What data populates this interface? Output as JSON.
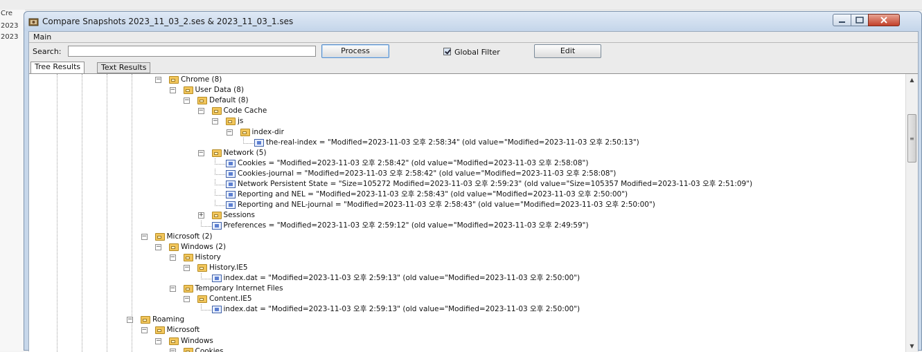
{
  "background": {
    "texts": [
      "Cre",
      "2023",
      "2023"
    ]
  },
  "window": {
    "title": "Compare Snapshots 2023_11_03_2.ses & 2023_11_03_1.ses",
    "buttons": {
      "minimize": "minimize-icon",
      "maximize": "maximize-icon",
      "close": "close-icon"
    }
  },
  "menu": {
    "main_label": "Main"
  },
  "search": {
    "label": "Search:",
    "value": "",
    "placeholder": ""
  },
  "toolbar": {
    "process_label": "Process",
    "global_filter_label": "Global Filter",
    "global_filter_checked": true,
    "edit_label": "Edit"
  },
  "tabs": [
    {
      "label": "Tree Results",
      "active": true
    },
    {
      "label": "Text Results",
      "active": false
    }
  ],
  "tree": {
    "rows": [
      {
        "depth": 0,
        "icon": "folder",
        "label": "Chrome (8)"
      },
      {
        "depth": 1,
        "icon": "folder",
        "label": "User Data (8)"
      },
      {
        "depth": 2,
        "icon": "folder",
        "label": "Default (8)"
      },
      {
        "depth": 3,
        "icon": "folder",
        "label": "Code Cache"
      },
      {
        "depth": 4,
        "icon": "folder",
        "label": "js"
      },
      {
        "depth": 5,
        "icon": "folder",
        "label": "index-dir"
      },
      {
        "depth": 6,
        "icon": "file",
        "label": "the-real-index = \"Modified=2023-11-03 오후 2:58:34\" (old value=\"Modified=2023-11-03 오후 2:50:13\")"
      },
      {
        "depth": 3,
        "icon": "folder",
        "label": "Network (5)"
      },
      {
        "depth": 4,
        "icon": "file",
        "label": "Cookies = \"Modified=2023-11-03 오후 2:58:42\" (old value=\"Modified=2023-11-03 오후 2:58:08\")"
      },
      {
        "depth": 4,
        "icon": "file",
        "label": "Cookies-journal = \"Modified=2023-11-03 오후 2:58:42\" (old value=\"Modified=2023-11-03 오후 2:58:08\")"
      },
      {
        "depth": 4,
        "icon": "file",
        "label": "Network Persistent State = \"Size=105272 Modified=2023-11-03 오후 2:59:23\" (old value=\"Size=105357 Modified=2023-11-03 오후 2:51:09\")"
      },
      {
        "depth": 4,
        "icon": "file",
        "label": "Reporting and NEL = \"Modified=2023-11-03 오후 2:58:43\" (old value=\"Modified=2023-11-03 오후 2:50:00\")"
      },
      {
        "depth": 4,
        "icon": "file",
        "label": "Reporting and NEL-journal = \"Modified=2023-11-03 오후 2:58:43\" (old value=\"Modified=2023-11-03 오후 2:50:00\")"
      },
      {
        "depth": 3,
        "icon": "folder",
        "label": "Sessions",
        "collapsed": true
      },
      {
        "depth": 3,
        "icon": "file",
        "label": "Preferences = \"Modified=2023-11-03 오후 2:59:12\" (old value=\"Modified=2023-11-03 오후 2:49:59\")"
      },
      {
        "depth": -1,
        "icon": "folder",
        "label": "Microsoft (2)"
      },
      {
        "depth": 0,
        "icon": "folder",
        "label": "Windows (2)"
      },
      {
        "depth": 1,
        "icon": "folder",
        "label": "History"
      },
      {
        "depth": 2,
        "icon": "folder",
        "label": "History.IE5"
      },
      {
        "depth": 3,
        "icon": "file",
        "label": "index.dat = \"Modified=2023-11-03 오후 2:59:13\" (old value=\"Modified=2023-11-03 오후 2:50:00\")"
      },
      {
        "depth": 1,
        "icon": "folder",
        "label": "Temporary Internet Files"
      },
      {
        "depth": 2,
        "icon": "folder",
        "label": "Content.IE5"
      },
      {
        "depth": 3,
        "icon": "file",
        "label": "index.dat = \"Modified=2023-11-03 오후 2:59:13\" (old value=\"Modified=2023-11-03 오후 2:50:00\")"
      },
      {
        "depth": -2,
        "icon": "folder",
        "label": "Roaming"
      },
      {
        "depth": -1,
        "icon": "folder",
        "label": "Microsoft"
      },
      {
        "depth": 0,
        "icon": "folder",
        "label": "Windows"
      },
      {
        "depth": 1,
        "icon": "folder",
        "label": "Cookies"
      }
    ]
  },
  "colors": {
    "folder": "#f2c65c",
    "file_icon": "#5c7fd1",
    "close_button": "#c2402a",
    "title_bar": "#c4d5ea"
  },
  "icons": {
    "app": "snapshot-app-icon",
    "folder": "folder-icon",
    "file": "file-icon",
    "scroll_up": "scroll-up-icon",
    "scroll_down": "scroll-down-icon"
  }
}
